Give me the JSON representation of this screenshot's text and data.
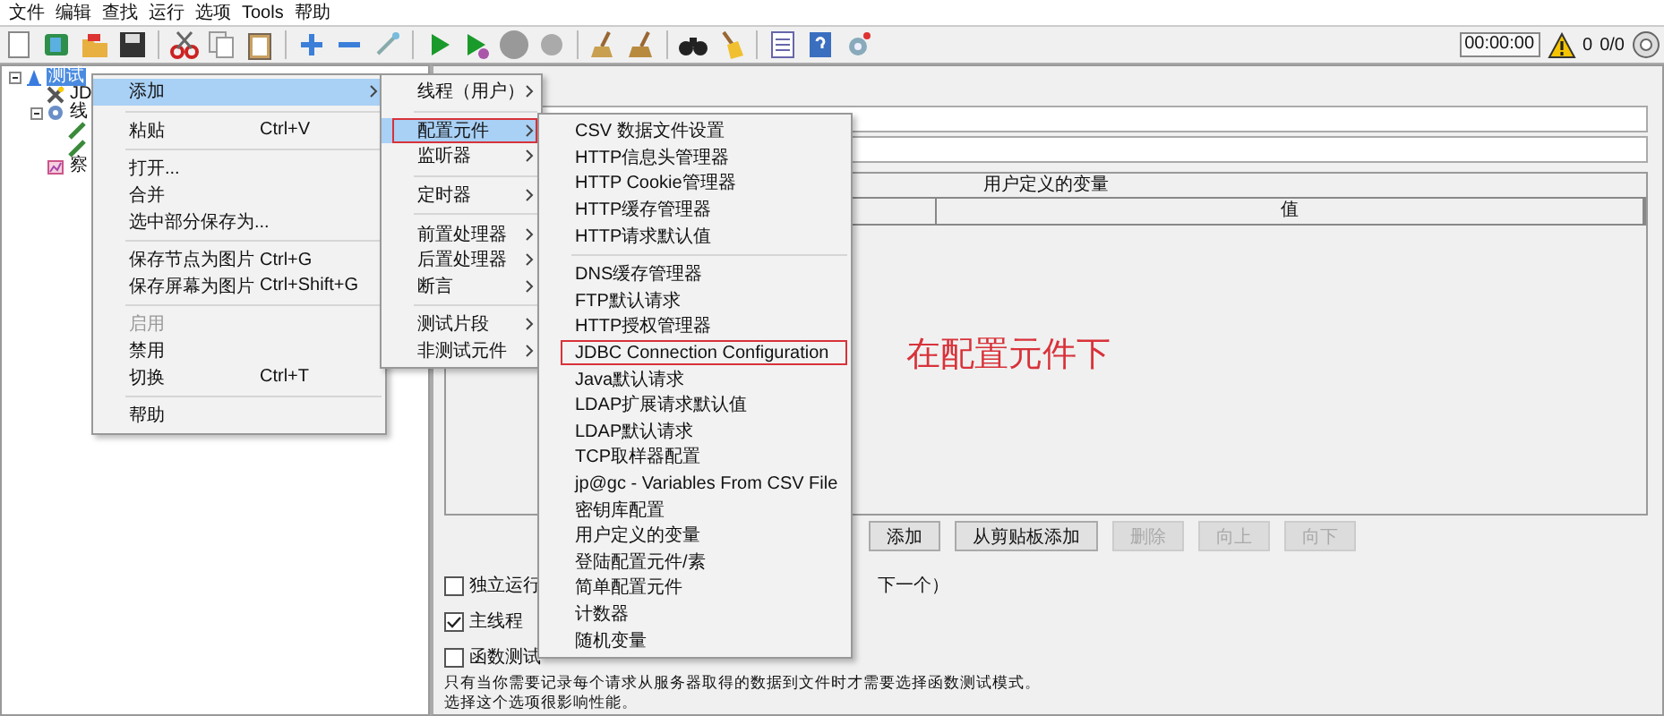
{
  "menubar": [
    {
      "label": "文件"
    },
    {
      "label": "编辑"
    },
    {
      "label": "查找"
    },
    {
      "label": "运行"
    },
    {
      "label": "选项"
    },
    {
      "label": "Tools"
    },
    {
      "label": "帮助"
    }
  ],
  "status": {
    "timer": "00:00:00",
    "warnings": "0",
    "threads": "0/0"
  },
  "tree": [
    {
      "label": "测试",
      "kind": "plan",
      "selected": true,
      "children": [
        {
          "label": "JD",
          "kind": "config",
          "selected": false
        },
        {
          "label": "线",
          "kind": "thread-group",
          "selected": false,
          "children": [
            {
              "kind": "sampler",
              "selected": false
            },
            {
              "kind": "sampler",
              "selected": false
            }
          ]
        },
        {
          "label": "察",
          "kind": "listener",
          "selected": false
        }
      ]
    }
  ],
  "panel": {
    "table": {
      "title": "用户定义的变量",
      "columns": [
        "值"
      ]
    },
    "buttons": [
      {
        "label": "添加",
        "disabled": false
      },
      {
        "label": "从剪贴板添加",
        "disabled": false
      },
      {
        "label": "删除",
        "disabled": true
      },
      {
        "label": "向上",
        "disabled": true
      },
      {
        "label": "向下",
        "disabled": true
      }
    ],
    "options": [
      {
        "label": "独立运行",
        "checked": false,
        "tail": "下一个）"
      },
      {
        "label": "主线程",
        "checked": true
      },
      {
        "label": "函数测试",
        "checked": false
      }
    ],
    "notes": [
      "只有当你需要记录每个请求从服务器取得的数据到文件时才需要选择函数测试模式。",
      "选择这个选项很影响性能。"
    ]
  },
  "annotation": {
    "text": "在配置元件下",
    "color": "#d8323a"
  },
  "context_menu": {
    "items": [
      {
        "kind": "item",
        "label": "添加",
        "submenu": true,
        "selected": true
      },
      {
        "kind": "separator"
      },
      {
        "kind": "item",
        "label": "粘贴",
        "shortcut": "Ctrl+V"
      },
      {
        "kind": "separator"
      },
      {
        "kind": "item",
        "label": "打开..."
      },
      {
        "kind": "item",
        "label": "合并"
      },
      {
        "kind": "item",
        "label": "选中部分保存为..."
      },
      {
        "kind": "separator"
      },
      {
        "kind": "item",
        "label": "保存节点为图片",
        "shortcut": "Ctrl+G"
      },
      {
        "kind": "item",
        "label": "保存屏幕为图片",
        "shortcut": "Ctrl+Shift+G"
      },
      {
        "kind": "separator"
      },
      {
        "kind": "item",
        "label": "启用",
        "disabled": true
      },
      {
        "kind": "item",
        "label": "禁用"
      },
      {
        "kind": "item",
        "label": "切换",
        "shortcut": "Ctrl+T"
      },
      {
        "kind": "separator"
      },
      {
        "kind": "item",
        "label": "帮助"
      }
    ]
  },
  "add_menu": {
    "items": [
      {
        "kind": "item",
        "label": "线程（用户）",
        "submenu": true
      },
      {
        "kind": "separator"
      },
      {
        "kind": "item",
        "label": "配置元件",
        "submenu": true,
        "selected": true,
        "marked": true
      },
      {
        "kind": "item",
        "label": "监听器",
        "submenu": true
      },
      {
        "kind": "separator"
      },
      {
        "kind": "item",
        "label": "定时器",
        "submenu": true
      },
      {
        "kind": "separator"
      },
      {
        "kind": "item",
        "label": "前置处理器",
        "submenu": true
      },
      {
        "kind": "item",
        "label": "后置处理器",
        "submenu": true
      },
      {
        "kind": "item",
        "label": "断言",
        "submenu": true
      },
      {
        "kind": "separator"
      },
      {
        "kind": "item",
        "label": "测试片段",
        "submenu": true
      },
      {
        "kind": "item",
        "label": "非测试元件",
        "submenu": true
      }
    ]
  },
  "config_menu": {
    "items": [
      {
        "kind": "item",
        "label": "CSV 数据文件设置"
      },
      {
        "kind": "item",
        "label": "HTTP信息头管理器"
      },
      {
        "kind": "item",
        "label": "HTTP Cookie管理器"
      },
      {
        "kind": "item",
        "label": "HTTP缓存管理器"
      },
      {
        "kind": "item",
        "label": "HTTP请求默认值"
      },
      {
        "kind": "separator"
      },
      {
        "kind": "item",
        "label": "DNS缓存管理器"
      },
      {
        "kind": "item",
        "label": "FTP默认请求"
      },
      {
        "kind": "item",
        "label": "HTTP授权管理器"
      },
      {
        "kind": "item",
        "label": "JDBC Connection Configuration",
        "marked": true
      },
      {
        "kind": "item",
        "label": "Java默认请求"
      },
      {
        "kind": "item",
        "label": "LDAP扩展请求默认值"
      },
      {
        "kind": "item",
        "label": "LDAP默认请求"
      },
      {
        "kind": "item",
        "label": "TCP取样器配置"
      },
      {
        "kind": "item",
        "label": "jp@gc - Variables From CSV File"
      },
      {
        "kind": "item",
        "label": "密钥库配置"
      },
      {
        "kind": "item",
        "label": "用户定义的变量"
      },
      {
        "kind": "item",
        "label": "登陆配置元件/素"
      },
      {
        "kind": "item",
        "label": "简单配置元件"
      },
      {
        "kind": "item",
        "label": "计数器"
      },
      {
        "kind": "item",
        "label": "随机变量"
      }
    ]
  }
}
